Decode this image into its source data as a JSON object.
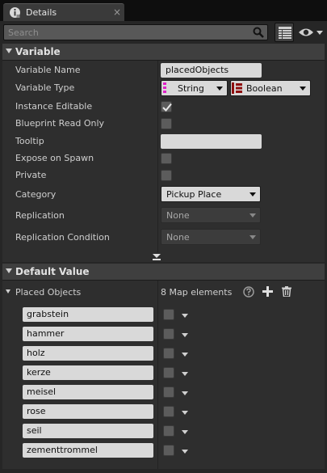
{
  "tab": {
    "title": "Details",
    "close_glyph": "×"
  },
  "search": {
    "placeholder": "Search",
    "value": ""
  },
  "variable_section": {
    "title": "Variable",
    "rows": {
      "name": {
        "label": "Variable Name",
        "value": "placedObjects"
      },
      "type": {
        "label": "Variable Type",
        "key_type": "String",
        "value_type": "Boolean",
        "key_color": "#e020c8",
        "value_color": "#8e0f0f"
      },
      "instance_editable": {
        "label": "Instance Editable",
        "checked": true
      },
      "blueprint_read_only": {
        "label": "Blueprint Read Only",
        "checked": false
      },
      "tooltip": {
        "label": "Tooltip",
        "value": ""
      },
      "expose_on_spawn": {
        "label": "Expose on Spawn",
        "checked": false
      },
      "private": {
        "label": "Private",
        "checked": false
      },
      "category": {
        "label": "Category",
        "value": "Pickup Place"
      },
      "replication": {
        "label": "Replication",
        "value": "None"
      },
      "replication_condition": {
        "label": "Replication Condition",
        "value": "None"
      }
    }
  },
  "default_section": {
    "title": "Default Value",
    "map_label": "Placed Objects",
    "map_count": "8 Map elements",
    "entries": [
      {
        "key": "grabstein"
      },
      {
        "key": "hammer"
      },
      {
        "key": "holz"
      },
      {
        "key": "kerze"
      },
      {
        "key": "meisel"
      },
      {
        "key": "rose"
      },
      {
        "key": "seil"
      },
      {
        "key": "zementtrommel"
      }
    ]
  },
  "icons": [
    "info-icon",
    "close-icon",
    "search-icon",
    "grid-icon",
    "eye-icon",
    "help-icon",
    "add-icon",
    "trash-icon",
    "checkmark-icon"
  ]
}
